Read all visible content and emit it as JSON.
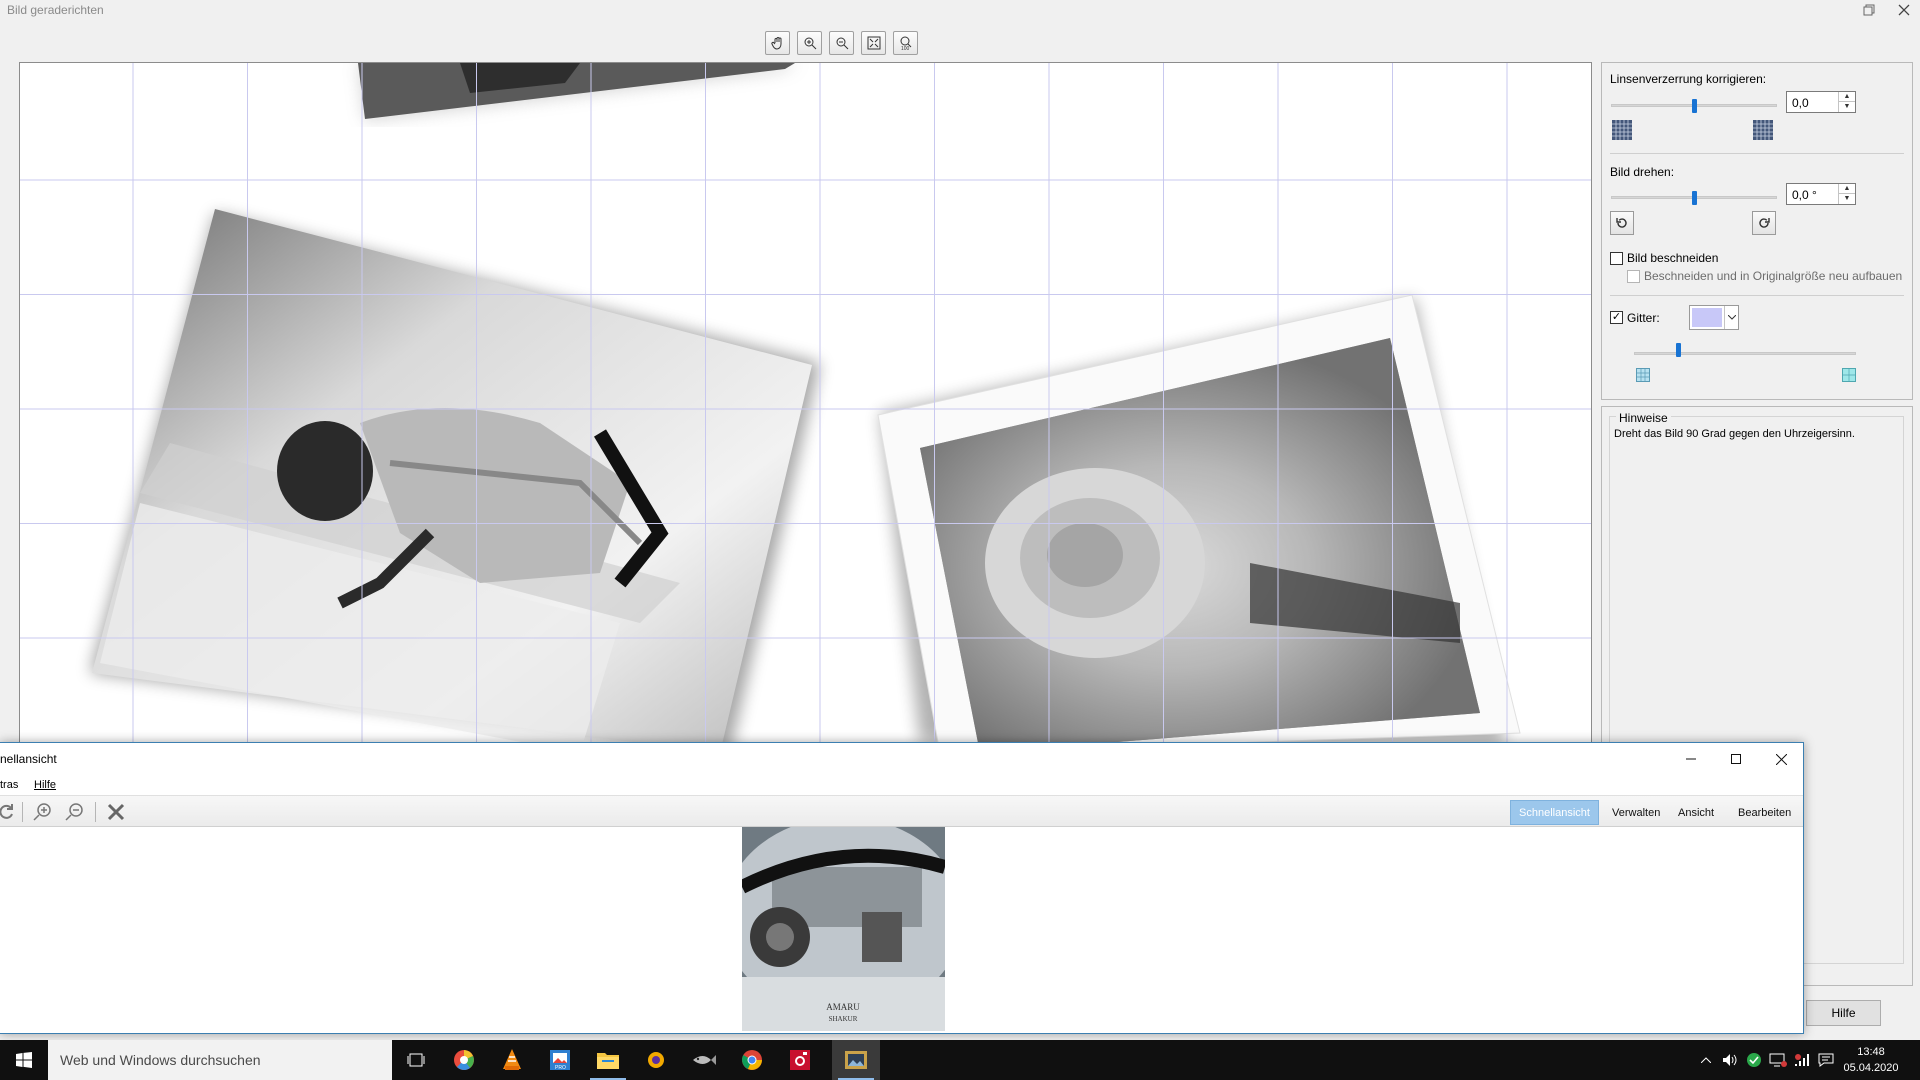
{
  "dialog": {
    "title": "Bild geraderichten",
    "restore_icon": "restore-icon",
    "close_icon": "close-icon"
  },
  "zoom_toolbar": {
    "buttons": [
      "hand-tool-icon",
      "zoom-in-icon",
      "zoom-out-icon",
      "fit-window-icon",
      "zoom-100-icon"
    ]
  },
  "panel": {
    "lens_label": "Linsenverzerrung korrigieren:",
    "lens_value": "0,0",
    "lens_level": 0.5,
    "rotate_label": "Bild drehen:",
    "rotate_value": "0,0 °",
    "rotate_level": 0.5,
    "crop_label": "Bild beschneiden",
    "crop_checked": false,
    "crop_resize_label": "Beschneiden und in Originalgröße neu aufbauen",
    "grid_label": "Gitter:",
    "grid_checked": true,
    "grid_color": "#c8c8f8",
    "grid_size_level": 0.2
  },
  "hints": {
    "title": "Hinweise",
    "text": "Dreht das Bild 90 Grad gegen den Uhrzeigersinn."
  },
  "help_button": "Hilfe",
  "viewer": {
    "title": "nellansicht",
    "menu": [
      "tras",
      "Hilfe"
    ],
    "tabs": [
      "Schnellansicht",
      "Verwalten",
      "Ansicht",
      "Bearbeiten"
    ],
    "active_tab": "Schnellansicht"
  },
  "taskbar": {
    "search_placeholder": "Web und Windows durchsuchen",
    "time": "13:48",
    "date": "05.04.2020"
  },
  "colors": {
    "accent": "#1873d3",
    "tab_active": "#9cc7ec",
    "grid_line": "#c9c9ef"
  }
}
